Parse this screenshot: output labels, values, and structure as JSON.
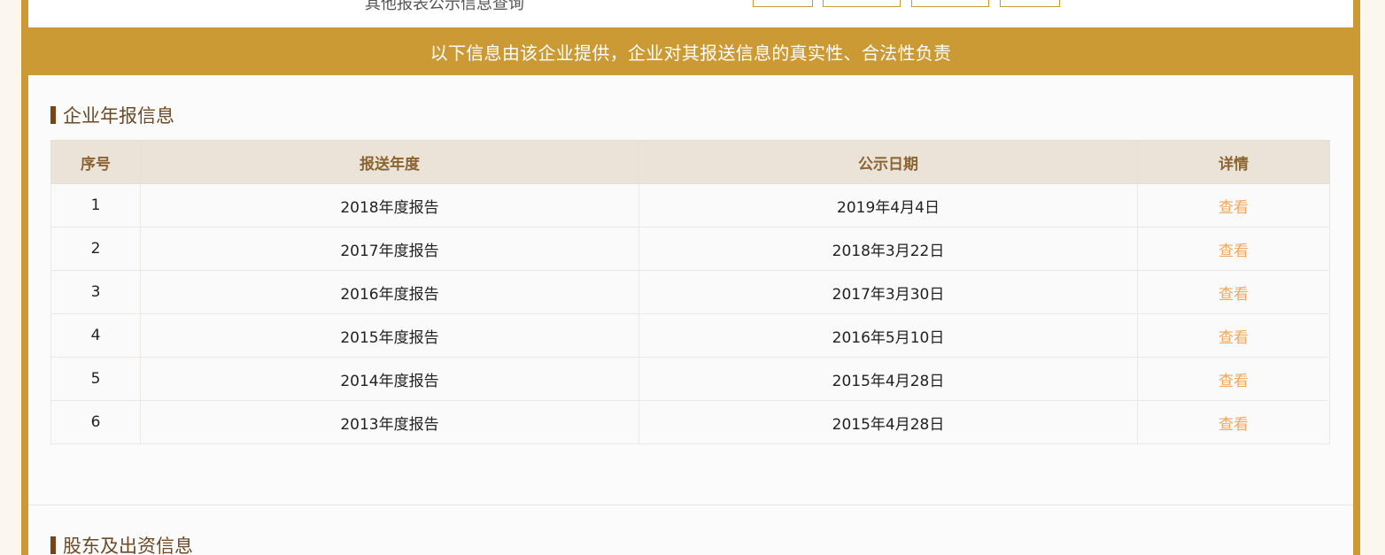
{
  "top": {
    "partial_text": "其他报表公示信息查询"
  },
  "banner": {
    "text": "以下信息由该企业提供，企业对其报送信息的真实性、合法性负责"
  },
  "annual_report_section": {
    "title": "企业年报信息",
    "columns": [
      "序号",
      "报送年度",
      "公示日期",
      "详情"
    ],
    "rows": [
      {
        "index": "1",
        "year": "2018年度报告",
        "date": "2019年4月4日",
        "action": "查看"
      },
      {
        "index": "2",
        "year": "2017年度报告",
        "date": "2018年3月22日",
        "action": "查看"
      },
      {
        "index": "3",
        "year": "2016年度报告",
        "date": "2017年3月30日",
        "action": "查看"
      },
      {
        "index": "4",
        "year": "2015年度报告",
        "date": "2016年5月10日",
        "action": "查看"
      },
      {
        "index": "5",
        "year": "2014年度报告",
        "date": "2015年4月28日",
        "action": "查看"
      },
      {
        "index": "6",
        "year": "2013年度报告",
        "date": "2015年4月28日",
        "action": "查看"
      }
    ]
  },
  "shareholder_section": {
    "title": "股东及出资信息"
  },
  "colors": {
    "frame": "#cb9a34",
    "header_text": "#8b6430",
    "link": "#f0a860",
    "title_bar": "#7a4514"
  }
}
